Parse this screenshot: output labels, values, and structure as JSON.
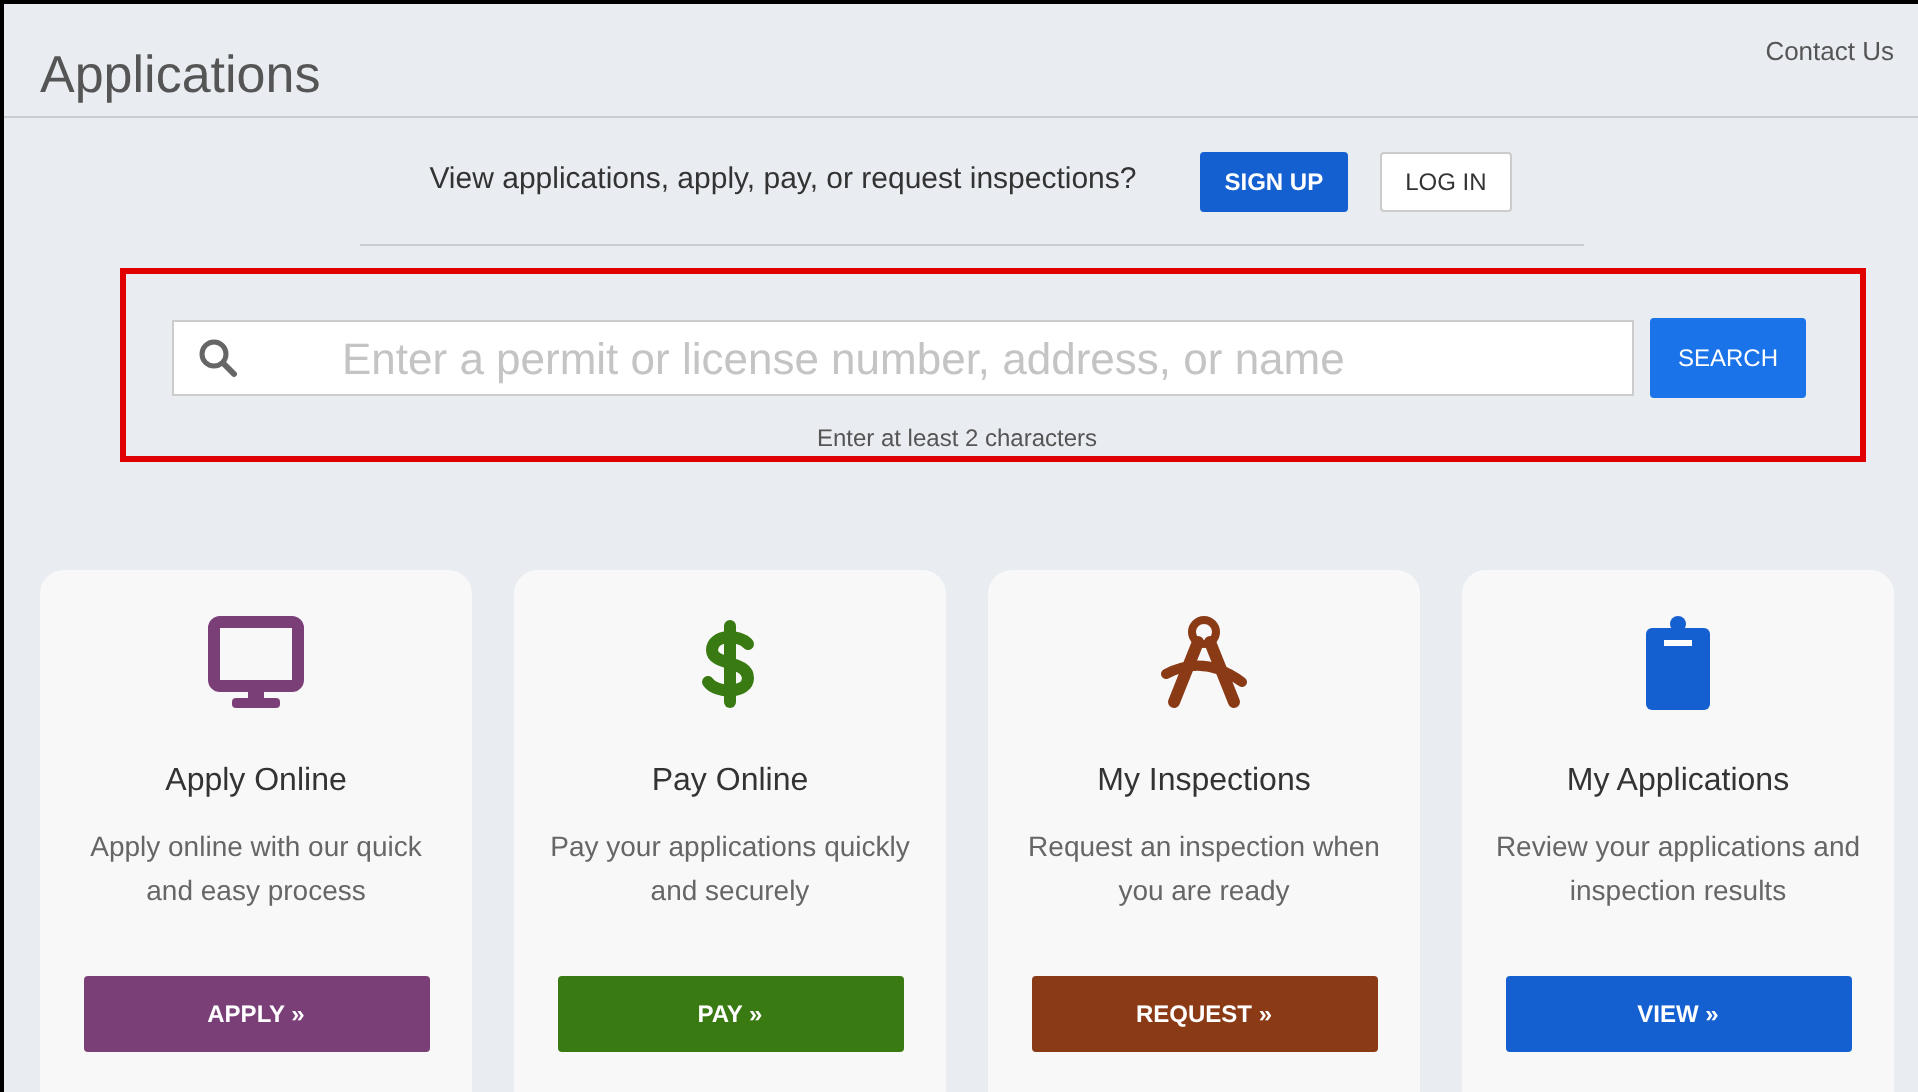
{
  "header": {
    "title": "Applications",
    "contact_link": "Contact Us"
  },
  "account_prompt": {
    "text": "View applications, apply, pay, or request inspections?",
    "signup": "SIGN UP",
    "login": "LOG IN"
  },
  "search": {
    "placeholder": "Enter a permit or license number, address, or name",
    "button": "SEARCH",
    "hint": "Enter at least 2 characters"
  },
  "cards": [
    {
      "kind": "monitor",
      "color": "#7b3f78",
      "title": "Apply Online",
      "description": "Apply online with our quick and easy process",
      "button": "APPLY »"
    },
    {
      "kind": "dollar",
      "color": "#3a7a12",
      "title": "Pay Online",
      "description": "Pay your applications quickly and securely",
      "button": "PAY »"
    },
    {
      "kind": "compass",
      "color": "#8b3a16",
      "title": "My Inspections",
      "description": "Request an inspection when you are ready",
      "button": "REQUEST »"
    },
    {
      "kind": "clipboard",
      "color": "#1560d0",
      "title": "My Applications",
      "description": "Review your applications and inspection results",
      "button": "VIEW »"
    }
  ]
}
